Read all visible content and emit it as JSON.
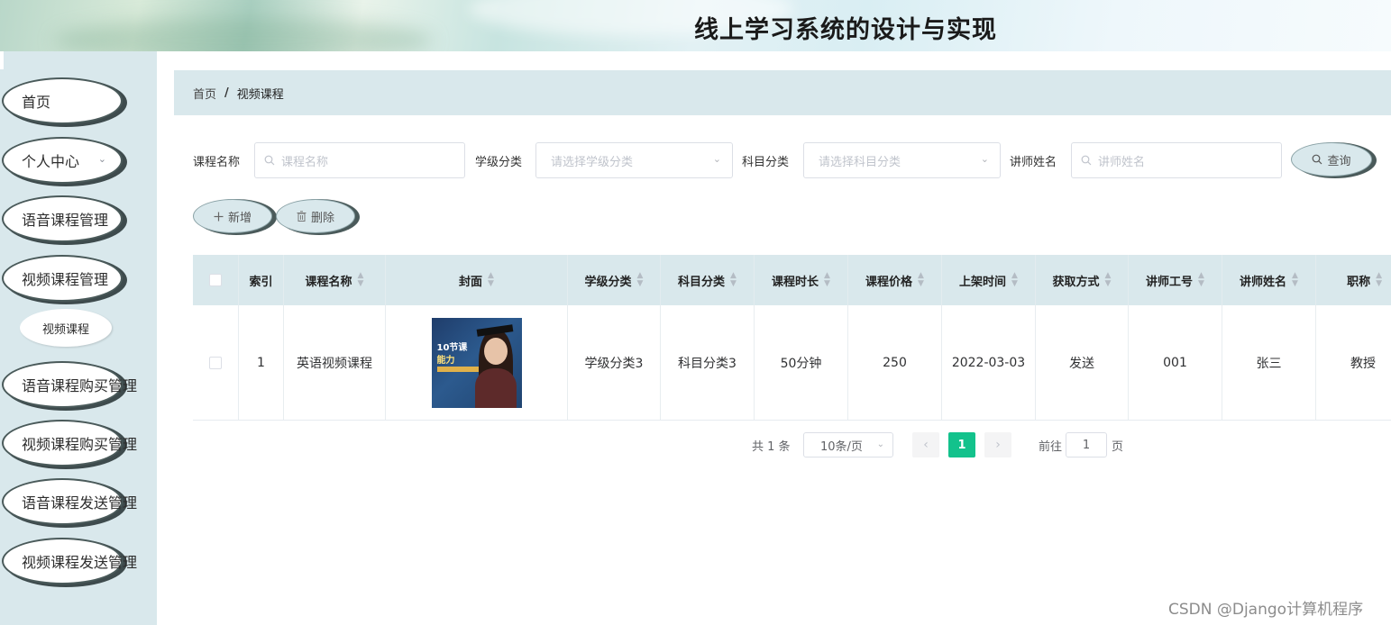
{
  "app": {
    "title": "线上学习系统的设计与实现"
  },
  "sidebar": {
    "items": [
      {
        "label": "首页"
      },
      {
        "label": "个人中心"
      },
      {
        "label": "语音课程管理"
      },
      {
        "label": "视频课程管理"
      },
      {
        "label": "语音课程购买管理"
      },
      {
        "label": "视频课程购买管理"
      },
      {
        "label": "语音课程发送管理"
      },
      {
        "label": "视频课程发送管理"
      }
    ],
    "sub_items": [
      {
        "label": "视频课程"
      }
    ]
  },
  "breadcrumb": {
    "home": "首页",
    "separator": "/",
    "current": "视频课程"
  },
  "search": {
    "course_name_label": "课程名称",
    "course_name_placeholder": "课程名称",
    "grade_label": "学级分类",
    "grade_placeholder": "请选择学级分类",
    "subject_label": "科目分类",
    "subject_placeholder": "请选择科目分类",
    "teacher_label": "讲师姓名",
    "teacher_placeholder": "讲师姓名",
    "query_button": "查询"
  },
  "actions": {
    "add_button": "新增",
    "delete_button": "删除"
  },
  "table": {
    "columns": [
      "索引",
      "课程名称",
      "封面",
      "学级分类",
      "科目分类",
      "课程时长",
      "课程价格",
      "上架时间",
      "获取方式",
      "讲师工号",
      "讲师姓名",
      "职称"
    ],
    "rows": [
      {
        "index": "1",
        "course_name": "英语视频课程",
        "grade": "学级分类3",
        "subject": "科目分类3",
        "duration": "50分钟",
        "price": "250",
        "date": "2022-03-03",
        "method": "发送",
        "teacher_id": "001",
        "teacher_name": "张三",
        "title": "教授"
      }
    ]
  },
  "pagination": {
    "total": "共 1 条",
    "page_size": "10条/页",
    "current": "1",
    "goto_label": "前往",
    "goto_value": "1",
    "page_suffix": "页"
  },
  "watermark": "CSDN @Django计算机程序",
  "colors": {
    "accent": "#13c28c",
    "panel": "#d9e8ec"
  }
}
